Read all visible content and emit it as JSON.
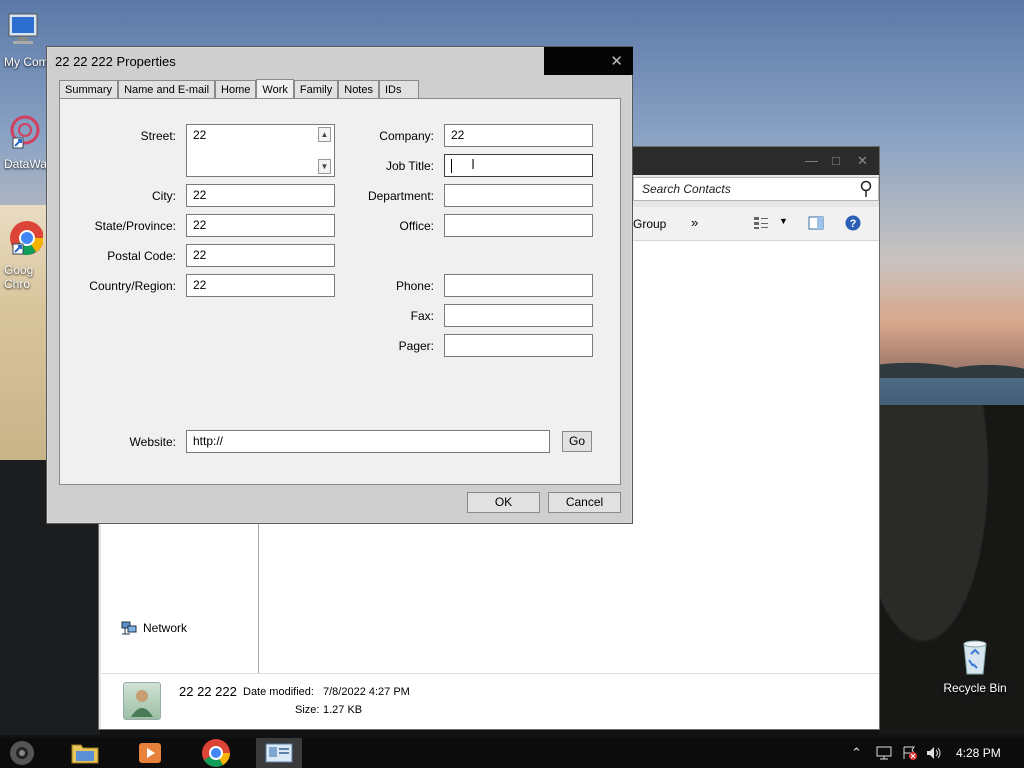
{
  "desktop": {
    "icons": [
      {
        "label": "My Com"
      },
      {
        "label": "DataWa"
      },
      {
        "label": "Goog Chro"
      },
      {
        "label": "Recycle Bin"
      }
    ]
  },
  "contacts_window": {
    "search_placeholder": "Search Contacts",
    "toolbar": {
      "group": "Group",
      "more": "»"
    },
    "nav": {
      "network": "Network"
    },
    "details": {
      "name": "22 22 222",
      "date_label": "Date modified:",
      "date_value": "7/8/2022 4:27 PM",
      "size_label": "Size:",
      "size_value": "1.27 KB"
    }
  },
  "dialog": {
    "title": "22 22 222 Properties",
    "tabs": [
      "Summary",
      "Name and E-mail",
      "Home",
      "Work",
      "Family",
      "Notes",
      "IDs"
    ],
    "active_tab": "Work",
    "fields": {
      "street": {
        "label": "Street:",
        "value": "22"
      },
      "city": {
        "label": "City:",
        "value": "22"
      },
      "state": {
        "label": "State/Province:",
        "value": "22"
      },
      "postal": {
        "label": "Postal Code:",
        "value": "22"
      },
      "country": {
        "label": "Country/Region:",
        "value": "22"
      },
      "company": {
        "label": "Company:",
        "value": "22"
      },
      "job_title": {
        "label": "Job Title:",
        "value": ""
      },
      "department": {
        "label": "Department:",
        "value": ""
      },
      "office": {
        "label": "Office:",
        "value": ""
      },
      "phone": {
        "label": "Phone:",
        "value": ""
      },
      "fax": {
        "label": "Fax:",
        "value": ""
      },
      "pager": {
        "label": "Pager:",
        "value": ""
      },
      "website": {
        "label": "Website:",
        "value": "http://"
      }
    },
    "buttons": {
      "go": "Go",
      "ok": "OK",
      "cancel": "Cancel"
    }
  },
  "taskbar": {
    "clock": "4:28 PM"
  }
}
